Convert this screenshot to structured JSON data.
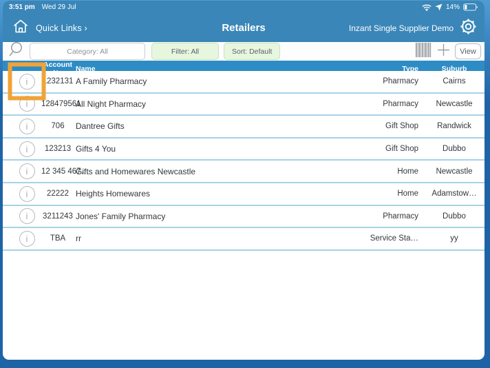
{
  "status_bar": {
    "time": "3:51 pm",
    "date": "Wed 29 Jul",
    "battery_percent": "14%"
  },
  "nav_bar": {
    "quick_links_label": "Quick Links ›",
    "title": "Retailers",
    "account_label": "Inzant Single Supplier Demo"
  },
  "toolbar": {
    "category_label": "Category: All",
    "filter_label": "Filter: All",
    "sort_label": "Sort: Default",
    "view_label": "View"
  },
  "table": {
    "columns": [
      "Account No",
      "Name",
      "Type",
      "Suburb"
    ],
    "rows": [
      {
        "account": "1232131",
        "name": "A Family Pharmacy",
        "type": "Pharmacy",
        "suburb": "Cairns",
        "highlighted": true
      },
      {
        "account": "128479561",
        "name": "All Night Pharmacy",
        "type": "Pharmacy",
        "suburb": "Newcastle",
        "highlighted": false
      },
      {
        "account": "706",
        "name": "Dantree Gifts",
        "type": "Gift Shop",
        "suburb": "Randwick",
        "highlighted": false
      },
      {
        "account": "123213",
        "name": "Gifts 4 You",
        "type": "Gift Shop",
        "suburb": "Dubbo",
        "highlighted": false
      },
      {
        "account": "12 345 467…",
        "name": "Gifts and Homewares Newcastle",
        "type": "Home",
        "suburb": "Newcastle",
        "highlighted": false
      },
      {
        "account": "22222",
        "name": "Heights Homewares",
        "type": "Home",
        "suburb": "Adamstow…",
        "highlighted": false
      },
      {
        "account": "3211243",
        "name": "Jones' Family Pharmacy",
        "type": "Pharmacy",
        "suburb": "Dubbo",
        "highlighted": false
      },
      {
        "account": "TBA",
        "name": "rr",
        "type": "Service Sta…",
        "suburb": "yy",
        "highlighted": false
      }
    ]
  },
  "icons": {
    "home": "house-outline",
    "settings": "gear-outline",
    "search": "magnifier",
    "barcode": "barcode-lines",
    "add": "plus",
    "info_glyph": "i",
    "wifi": "wifi-fan",
    "location": "navigation-arrow",
    "battery": "battery-low"
  },
  "colors": {
    "nav-blue": "#3a86b8",
    "header-blue": "#2e8cc4",
    "row-separator": "#a6d2e8",
    "highlight-orange": "#f0a338",
    "pill-green-bg": "#e7f6df",
    "pill-green-border": "#c4e5ba",
    "frame-blue": "#1d63a6",
    "frame-blue-light": "#4f9cd4"
  }
}
